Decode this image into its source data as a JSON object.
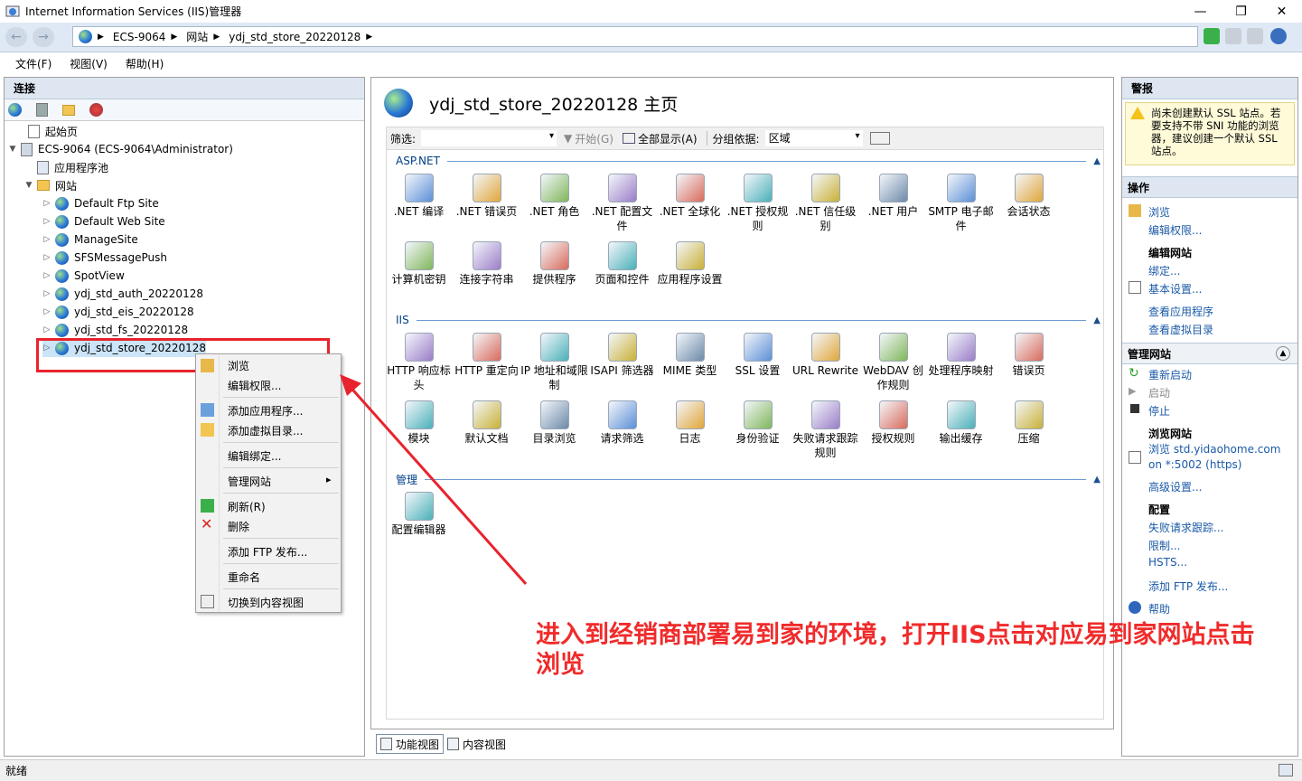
{
  "window": {
    "title": "Internet Information Services (IIS)管理器",
    "controls": [
      "—",
      "❐",
      "✕"
    ]
  },
  "address": {
    "crumbs": [
      "ECS-9064",
      "网站",
      "ydj_std_store_20220128"
    ]
  },
  "menu": [
    "文件(F)",
    "视图(V)",
    "帮助(H)"
  ],
  "connections": {
    "title": "连接",
    "tree": {
      "start_page": "起始页",
      "server": "ECS-9064 (ECS-9064\\Administrator)",
      "app_pools": "应用程序池",
      "sites": "网站",
      "site_list": [
        "Default Ftp Site",
        "Default Web Site",
        "ManageSite",
        "SFSMessagePush",
        "SpotView",
        "ydj_std_auth_20220128",
        "ydj_std_eis_20220128",
        "ydj_std_fs_20220128",
        "ydj_std_store_20220128"
      ]
    }
  },
  "context_menu": {
    "items": [
      "浏览",
      "编辑权限...",
      "添加应用程序...",
      "添加虚拟目录...",
      "编辑绑定...",
      "管理网站",
      "刷新(R)",
      "删除",
      "添加 FTP 发布...",
      "重命名",
      "切换到内容视图"
    ],
    "submenu_arrow": "▸"
  },
  "main": {
    "title": "ydj_std_store_20220128 主页",
    "filter": {
      "label": "筛选:",
      "go": "开始(G)",
      "show_all": "全部显示(A)",
      "group_by_label": "分组依据:",
      "group_by_value": "区域"
    },
    "sections": {
      "aspnet": "ASP.NET",
      "iis": "IIS",
      "mgmt": "管理"
    },
    "aspnet_features": [
      ".NET 编译",
      ".NET 错误页",
      ".NET 角色",
      ".NET 配置文件",
      ".NET 全球化",
      ".NET 授权规则",
      ".NET 信任级别",
      ".NET 用户",
      "SMTP 电子邮件",
      "会话状态",
      "计算机密钥",
      "连接字符串",
      "提供程序",
      "页面和控件",
      "应用程序设置"
    ],
    "iis_features": [
      "HTTP 响应标头",
      "HTTP 重定向",
      "IP 地址和域限制",
      "ISAPI 筛选器",
      "MIME 类型",
      "SSL 设置",
      "URL Rewrite",
      "WebDAV 创作规则",
      "处理程序映射",
      "错误页",
      "模块",
      "默认文档",
      "目录浏览",
      "请求筛选",
      "日志",
      "身份验证",
      "失败请求跟踪规则",
      "授权规则",
      "输出缓存",
      "压缩"
    ],
    "mgmt_features": [
      "配置编辑器"
    ],
    "view_tabs": [
      "功能视图",
      "内容视图"
    ]
  },
  "alerts": {
    "title": "警报",
    "message": "尚未创建默认 SSL 站点。若要支持不带 SNI 功能的浏览器，建议创建一个默认 SSL 站点。"
  },
  "actions": {
    "title": "操作",
    "browse": "浏览",
    "edit_perms": "编辑权限...",
    "edit_site": "编辑网站",
    "bindings": "绑定...",
    "basic": "基本设置...",
    "view_apps": "查看应用程序",
    "view_vdirs": "查看虚拟目录",
    "manage_site": "管理网站",
    "restart": "重新启动",
    "start": "启动",
    "stop": "停止",
    "browse_site": "浏览网站",
    "browse_link": "浏览 std.yidaohome.com on *:5002 (https)",
    "advanced": "高级设置...",
    "config": "配置",
    "failed_tracing": "失败请求跟踪...",
    "limits": "限制...",
    "hsts": "HSTS...",
    "add_ftp": "添加 FTP 发布...",
    "help": "帮助"
  },
  "status": "就绪",
  "annotation": "进入到经销商部署易到家的环境，打开IIS点击对应易到家网站点击浏览"
}
